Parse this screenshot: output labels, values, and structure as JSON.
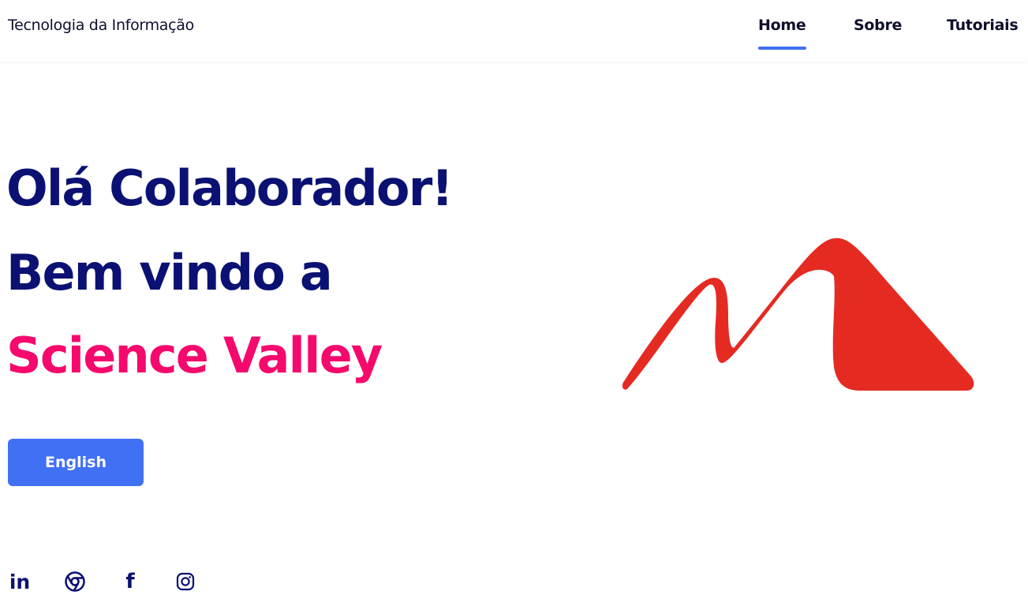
{
  "header": {
    "brand": "Tecnologia da Informação",
    "nav": [
      {
        "label": "Home",
        "active": true
      },
      {
        "label": "Sobre",
        "active": false
      },
      {
        "label": "Tutoriais",
        "active": false
      }
    ]
  },
  "hero": {
    "line1": "Olá Colaborador!",
    "line2": "Bem vindo a",
    "line3": "Science Valley",
    "button_label": "English"
  },
  "logo": {
    "icon": "science-valley-mountain-logo",
    "color": "#e52a22"
  },
  "social": [
    {
      "icon": "linkedin-icon",
      "glyph": "in"
    },
    {
      "icon": "chrome-icon",
      "glyph": ""
    },
    {
      "icon": "facebook-icon",
      "glyph": "f"
    },
    {
      "icon": "instagram-icon",
      "glyph": ""
    }
  ],
  "colors": {
    "primary": "#4070f4",
    "heading": "#0a1172",
    "accent": "#f5096c",
    "logo_red": "#e52a22"
  }
}
